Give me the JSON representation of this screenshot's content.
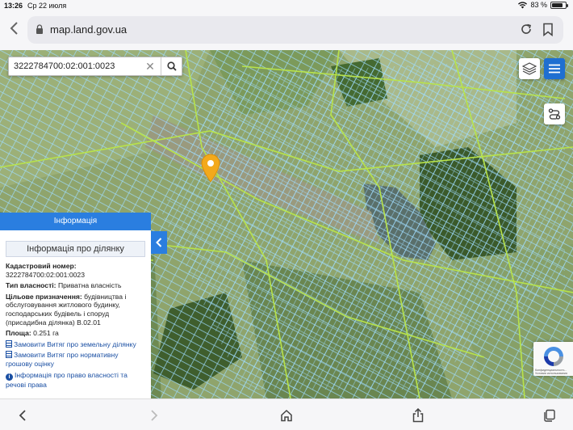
{
  "status": {
    "time": "13:26",
    "date": "Ср 22 июля",
    "battery": "83 %",
    "battery_level": 0.83
  },
  "browser": {
    "url": "map.land.gov.ua"
  },
  "search": {
    "value": "3222784700:02:001:0023"
  },
  "panel": {
    "header": "Інформація",
    "subtitle": "Інформація про ділянку",
    "cadastral_label": "Кадастровий номер:",
    "cadastral_value": "3222784700:02:001:0023",
    "ownership_label": "Тип власності:",
    "ownership_value": "Приватна власність",
    "purpose_label": "Цільове призначення:",
    "purpose_value": "будівництва і обслуговування житлового будинку, господарських будівель і споруд (присадибна ділянка) B.02.01",
    "area_label": "Площа:",
    "area_value": "0.251 га",
    "links": [
      "Замовити Витяг про земельну ділянку",
      "Замовити Витяг про нормативну грошову оцінку",
      "Інформація про право власності та речові права"
    ]
  },
  "recaptcha": {
    "text": "Конфиденциальность - Условия использования"
  },
  "colors": {
    "accent": "#2a7ee0",
    "marker": "#f3a91c",
    "parcel": "#8fd4ff",
    "road": "#b8e34a"
  }
}
